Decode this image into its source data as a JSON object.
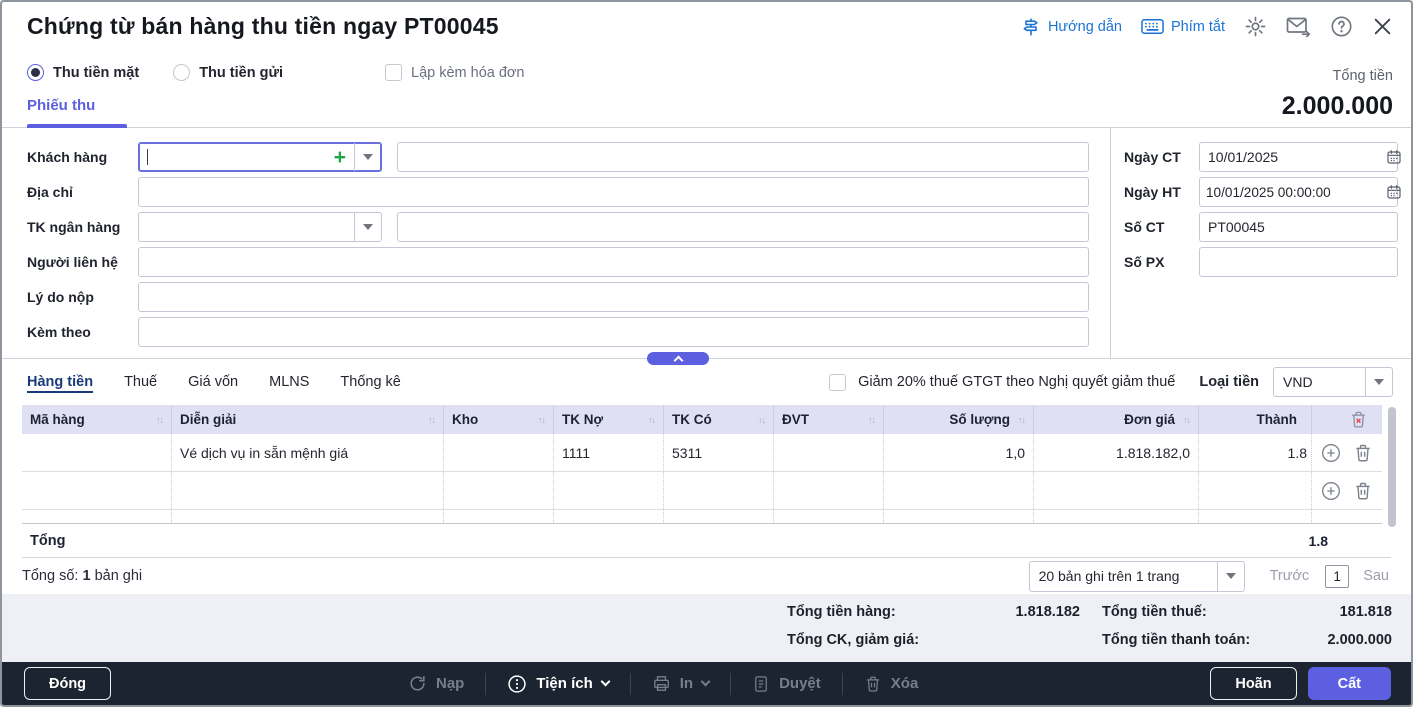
{
  "window": {
    "title": "Chứng từ bán hàng thu tiền ngay PT00045"
  },
  "titlebar": {
    "guide": "Hướng dẫn",
    "shortcuts": "Phím tắt"
  },
  "payment_options": {
    "cash": "Thu tiền mặt",
    "bank": "Thu tiền gửi",
    "with_invoice": "Lập kèm hóa đơn",
    "selected": "Thu tiền mặt"
  },
  "total_panel": {
    "label": "Tổng tiền",
    "value": "2.000.000"
  },
  "receipt_tab": "Phiếu thu",
  "form": {
    "customer_label": "Khách hàng",
    "customer_value": "",
    "address_label": "Địa chỉ",
    "address_value": "",
    "bank_account_label": "TK ngân hàng",
    "bank_account_value": "",
    "contact_label": "Người liên hệ",
    "contact_value": "",
    "reason_label": "Lý do nộp",
    "reason_value": "",
    "attachment_label": "Kèm theo",
    "attachment_value": "",
    "doc_date_label": "Ngày CT",
    "doc_date_value": "10/01/2025",
    "posting_date_label": "Ngày HT",
    "posting_date_value": "10/01/2025 00:00:00",
    "doc_no_label": "Số CT",
    "doc_no_value": "PT00045",
    "delivery_no_label": "Số PX",
    "delivery_no_value": ""
  },
  "detail_tabs": [
    "Hàng tiền",
    "Thuế",
    "Giá vốn",
    "MLNS",
    "Thống kê"
  ],
  "active_detail_tab": "Hàng tiền",
  "vat_reduction_checkbox": "Giảm 20% thuế GTGT theo Nghị quyết giảm thuế",
  "currency": {
    "label": "Loại tiền",
    "value": "VND"
  },
  "table": {
    "headers": [
      "Mã hàng",
      "Diễn giải",
      "Kho",
      "TK Nợ",
      "TK Có",
      "ĐVT",
      "Số lượng",
      "Đơn giá",
      "Thành"
    ],
    "rows": [
      [
        "",
        "Vé dịch vụ in sẵn mệnh giá",
        "",
        "1111",
        "5311",
        "",
        "1,0",
        "1.818.182,0",
        "1.8"
      ],
      [
        "",
        "",
        "",
        "",
        "",
        "",
        "",
        "",
        ""
      ]
    ],
    "footer_label": "Tổng",
    "footer_amount": "1.8"
  },
  "pagination": {
    "summary_prefix": "Tổng số:",
    "summary_count": "1",
    "summary_suffix": "bản ghi",
    "page_size": "20 bản ghi trên 1 trang",
    "prev": "Trước",
    "current_page": "1",
    "next": "Sau"
  },
  "totals": {
    "goods_label": "Tổng tiền hàng:",
    "goods_value": "1.818.182",
    "tax_label": "Tổng tiền thuế:",
    "tax_value": "181.818",
    "discount_label": "Tổng CK, giảm giá:",
    "discount_value": "",
    "payment_label": "Tổng tiền thanh toán:",
    "payment_value": "2.000.000"
  },
  "footer": {
    "close": "Đóng",
    "reload": "Nạp",
    "utilities": "Tiện ích",
    "print": "In",
    "approve": "Duyệt",
    "delete": "Xóa",
    "postpone": "Hoãn",
    "save": "Cất"
  },
  "colors": {
    "accent": "#5b5fe0",
    "link": "#1b74d4",
    "footer_bg": "#1d2431",
    "table_header_bg": "#dfe0f3",
    "totals_bg": "#eef0f6",
    "add_green": "#21a44a",
    "delete_red": "#e5484d"
  }
}
